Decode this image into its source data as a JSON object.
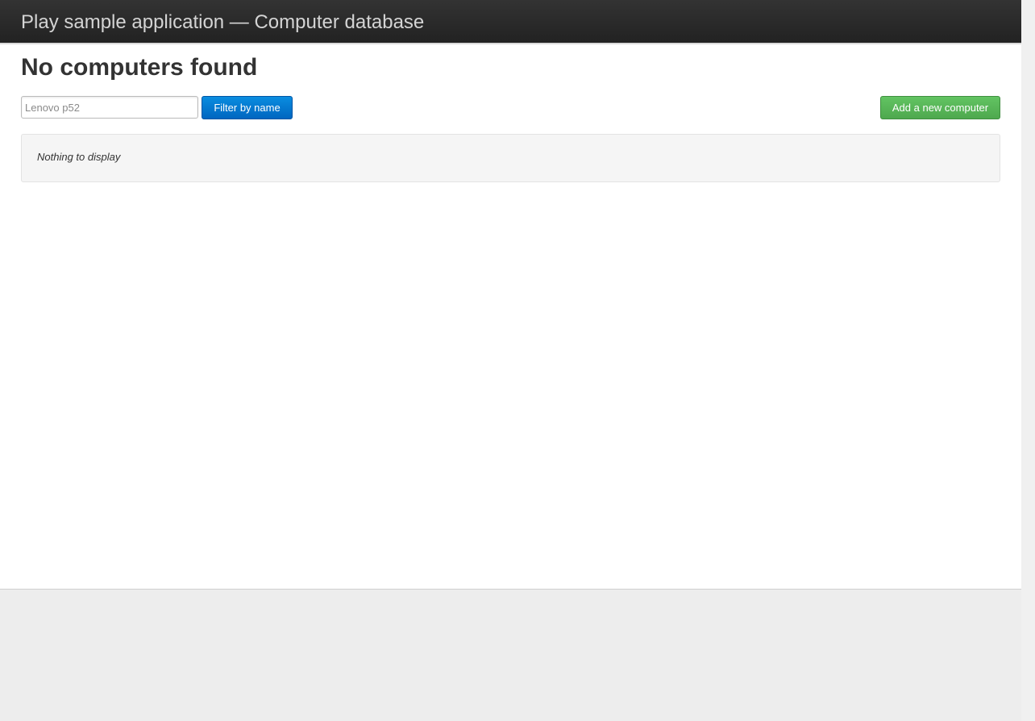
{
  "header": {
    "app_title": "Play sample application — Computer database"
  },
  "main": {
    "page_title": "No computers found",
    "search": {
      "value": "",
      "placeholder": "Lenovo p52"
    },
    "filter_button_label": "Filter by name",
    "add_button_label": "Add a new computer",
    "empty_message": "Nothing to display"
  },
  "colors": {
    "topbar": "#222222",
    "filter_button": "#0074cc",
    "add_button": "#5bb75b",
    "background": "#ededed"
  }
}
